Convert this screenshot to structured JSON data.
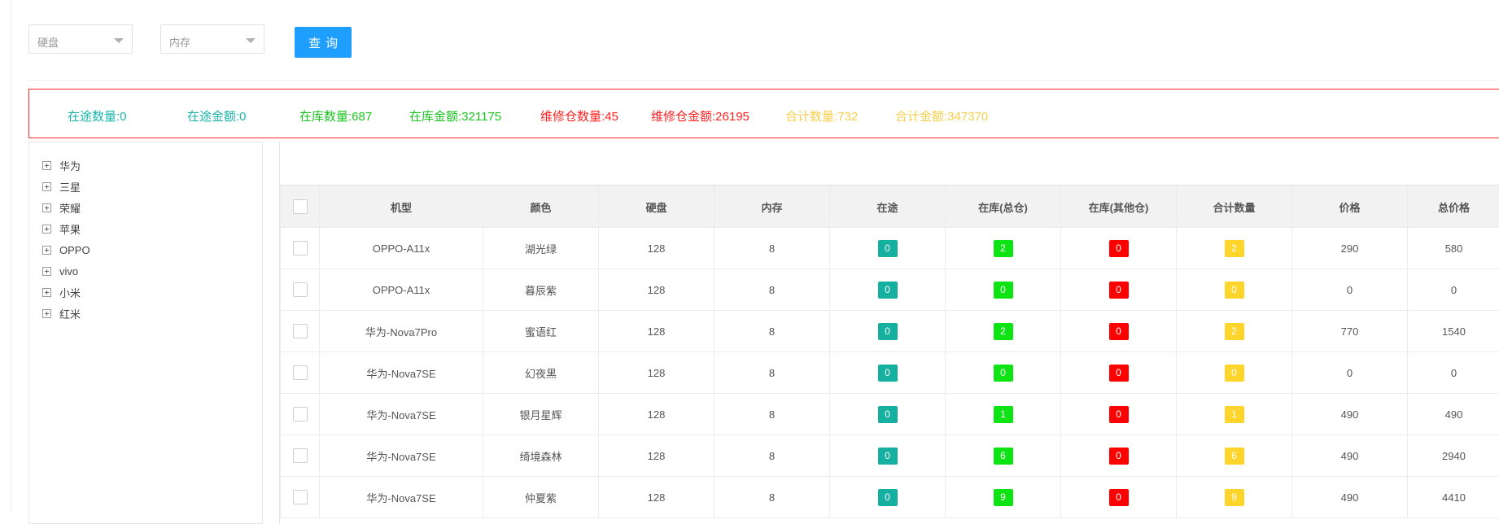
{
  "filters": {
    "disk_placeholder": "硬盘",
    "memory_placeholder": "内存",
    "query_label": "查询"
  },
  "summary": [
    {
      "text": "在途数量:0",
      "color": "#1ab4ab"
    },
    {
      "text": "在途金额:0",
      "color": "#1ab4ab"
    },
    {
      "text": "在库数量:687",
      "color": "#19c41e"
    },
    {
      "text": "在库金额:321175",
      "color": "#19c41e"
    },
    {
      "text": "维修仓数量:45",
      "color": "#ff2020"
    },
    {
      "text": "维修仓金额:26195",
      "color": "#ff2020"
    },
    {
      "text": "合计数量:732",
      "color": "#f7cf4a"
    },
    {
      "text": "合计金额:347370",
      "color": "#f7cf4a"
    }
  ],
  "tree": [
    "华为",
    "三星",
    "荣耀",
    "苹果",
    "OPPO",
    "vivo",
    "小米",
    "红米"
  ],
  "table": {
    "headers": [
      "机型",
      "颜色",
      "硬盘",
      "内存",
      "在途",
      "在库(总仓)",
      "在库(其他仓)",
      "合计数量",
      "价格",
      "总价格"
    ],
    "rows": [
      [
        "OPPO-A11x",
        "湖光绿",
        "128",
        "8",
        "0",
        "2",
        "0",
        "2",
        "290",
        "580"
      ],
      [
        "OPPO-A11x",
        "暮辰紫",
        "128",
        "8",
        "0",
        "0",
        "0",
        "0",
        "0",
        "0"
      ],
      [
        "华为-Nova7Pro",
        "蜜语红",
        "128",
        "8",
        "0",
        "2",
        "0",
        "2",
        "770",
        "1540"
      ],
      [
        "华为-Nova7SE",
        "幻夜黑",
        "128",
        "8",
        "0",
        "0",
        "0",
        "0",
        "0",
        "0"
      ],
      [
        "华为-Nova7SE",
        "银月星辉",
        "128",
        "8",
        "0",
        "1",
        "0",
        "1",
        "490",
        "490"
      ],
      [
        "华为-Nova7SE",
        "绮境森林",
        "128",
        "8",
        "0",
        "6",
        "0",
        "6",
        "490",
        "2940"
      ],
      [
        "华为-Nova7SE",
        "仲夏紫",
        "128",
        "8",
        "0",
        "9",
        "0",
        "9",
        "490",
        "4410"
      ]
    ]
  }
}
